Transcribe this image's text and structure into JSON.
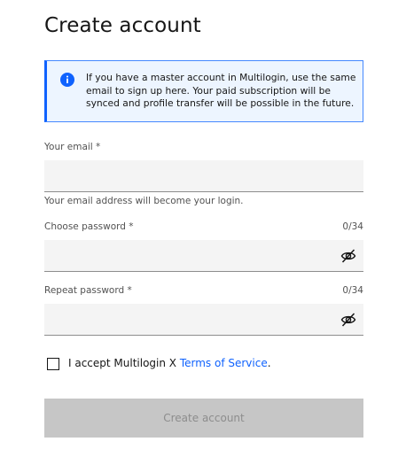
{
  "page": {
    "title": "Create account"
  },
  "notice": {
    "text": "If you have a master account in Multilogin, use the same email to sign up here. Your paid subscription will be synced and profile transfer will be possible in the future.",
    "icon": "info-icon",
    "accent_color": "#0f62fe"
  },
  "email": {
    "label": "Your email *",
    "value": "",
    "helper": "Your email address will become your login."
  },
  "password": {
    "label": "Choose password *",
    "counter": "0/34",
    "value": "",
    "icon": "eye-off-icon"
  },
  "repeat_password": {
    "label": "Repeat password *",
    "counter": "0/34",
    "value": "",
    "icon": "eye-off-icon"
  },
  "terms": {
    "checked": false,
    "prefix": "I accept Multilogin X ",
    "link": "Terms of Service",
    "suffix": "."
  },
  "submit": {
    "label": "Create account",
    "disabled": true
  }
}
